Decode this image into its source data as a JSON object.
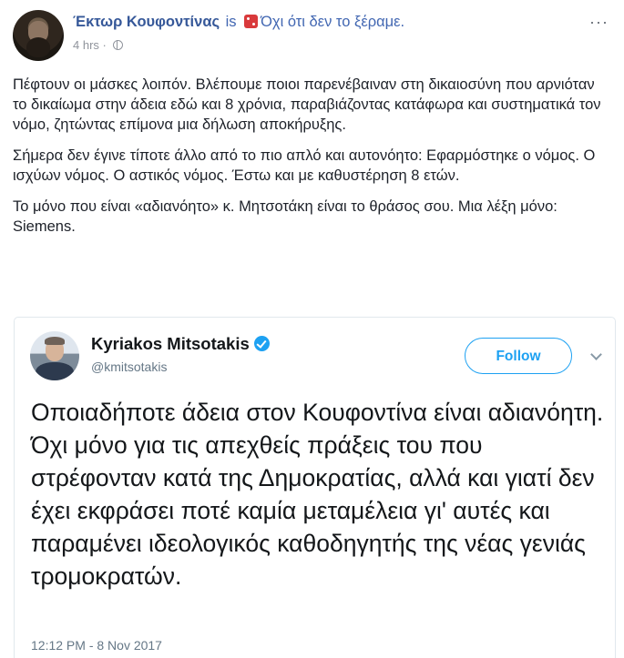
{
  "post": {
    "author": "Έκτωρ Κουφοντίνας",
    "is_text": "is",
    "feeling_icon": "die-icon",
    "feeling": "Όχι ότι δεν το ξέραμε.",
    "time": "4 hrs ·",
    "privacy_icon": "globe-icon",
    "more_icon": "more-icon",
    "more": "···",
    "paragraphs": [
      "Πέφτουν οι μάσκες λοιπόν. Βλέπουμε ποιοι παρενέβαιναν στη δικαιοσύνη που αρνιόταν το δικαίωμα στην άδεια εδώ και 8 χρόνια, παραβιάζοντας κατάφωρα και συστηματικά τον νόμο, ζητώντας επίμονα μια δήλωση αποκήρυξης.",
      "Σήμερα δεν έγινε τίποτε άλλο από το πιο απλό και αυτονόητο: Εφαρμόστηκε ο νόμος. Ο ισχύων νόμος. Ο αστικός νόμος. Έστω και με καθυστέρηση 8 ετών.",
      "Το μόνο που είναι «αδιανόητο» κ. Μητσοτάκη είναι το θράσος σου. Μια λέξη μόνο: Siemens."
    ]
  },
  "tweet": {
    "name": "Kyriakos Mitsotakis",
    "handle": "@kmitsotakis",
    "follow_label": "Follow",
    "text": "Οποιαδήποτε άδεια στον Κουφοντίνα είναι αδιανόητη. Όχι μόνο για τις απεχθείς πράξεις του που στρέφονταν κατά της Δημοκρατίας, αλλά και γιατί δεν έχει εκφράσει ποτέ καμία μεταμέλεια γι' αυτές και παραμένει ιδεολογικός καθοδηγητής της νέας γενιάς τρομοκρατών.",
    "timestamp": "12:12 PM - 8 Nov 2017",
    "accent_color": "#1da1f2"
  },
  "colors": {
    "link": "#365899",
    "meta": "#90949c"
  }
}
